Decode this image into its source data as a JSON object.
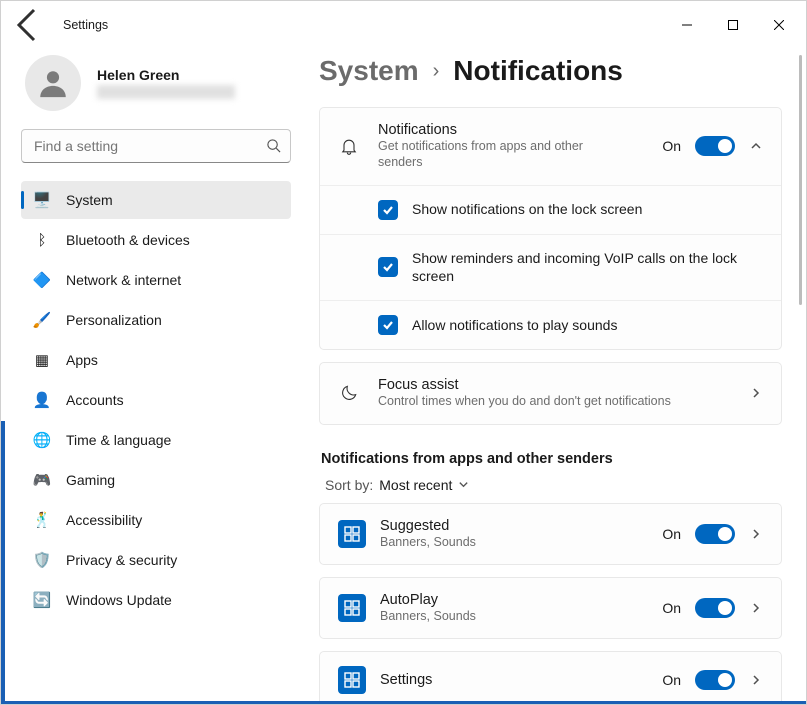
{
  "window": {
    "title": "Settings"
  },
  "profile": {
    "name": "Helen Green"
  },
  "search": {
    "placeholder": "Find a setting"
  },
  "nav": [
    {
      "icon": "🖥️",
      "label": "System",
      "active": true
    },
    {
      "icon": "ᛒ",
      "label": "Bluetooth & devices"
    },
    {
      "icon": "🔷",
      "label": "Network & internet"
    },
    {
      "icon": "🖌️",
      "label": "Personalization"
    },
    {
      "icon": "▦",
      "label": "Apps"
    },
    {
      "icon": "👤",
      "label": "Accounts"
    },
    {
      "icon": "🌐",
      "label": "Time & language"
    },
    {
      "icon": "🎮",
      "label": "Gaming"
    },
    {
      "icon": "🕺",
      "label": "Accessibility"
    },
    {
      "icon": "🛡️",
      "label": "Privacy & security"
    },
    {
      "icon": "🔄",
      "label": "Windows Update"
    }
  ],
  "breadcrumb": {
    "parent": "System",
    "child": "Notifications"
  },
  "notifCard": {
    "title": "Notifications",
    "subtitle": "Get notifications from apps and other senders",
    "state": "On",
    "opts": [
      "Show notifications on the lock screen",
      "Show reminders and incoming VoIP calls on the lock screen",
      "Allow notifications to play sounds"
    ]
  },
  "focusCard": {
    "title": "Focus assist",
    "subtitle": "Control times when you do and don't get notifications"
  },
  "appsSection": {
    "header": "Notifications from apps and other senders",
    "sortLabel": "Sort by:",
    "sortValue": "Most recent",
    "apps": [
      {
        "name": "Suggested",
        "detail": "Banners, Sounds",
        "state": "On"
      },
      {
        "name": "AutoPlay",
        "detail": "Banners, Sounds",
        "state": "On"
      },
      {
        "name": "Settings",
        "detail": "",
        "state": "On"
      }
    ]
  }
}
